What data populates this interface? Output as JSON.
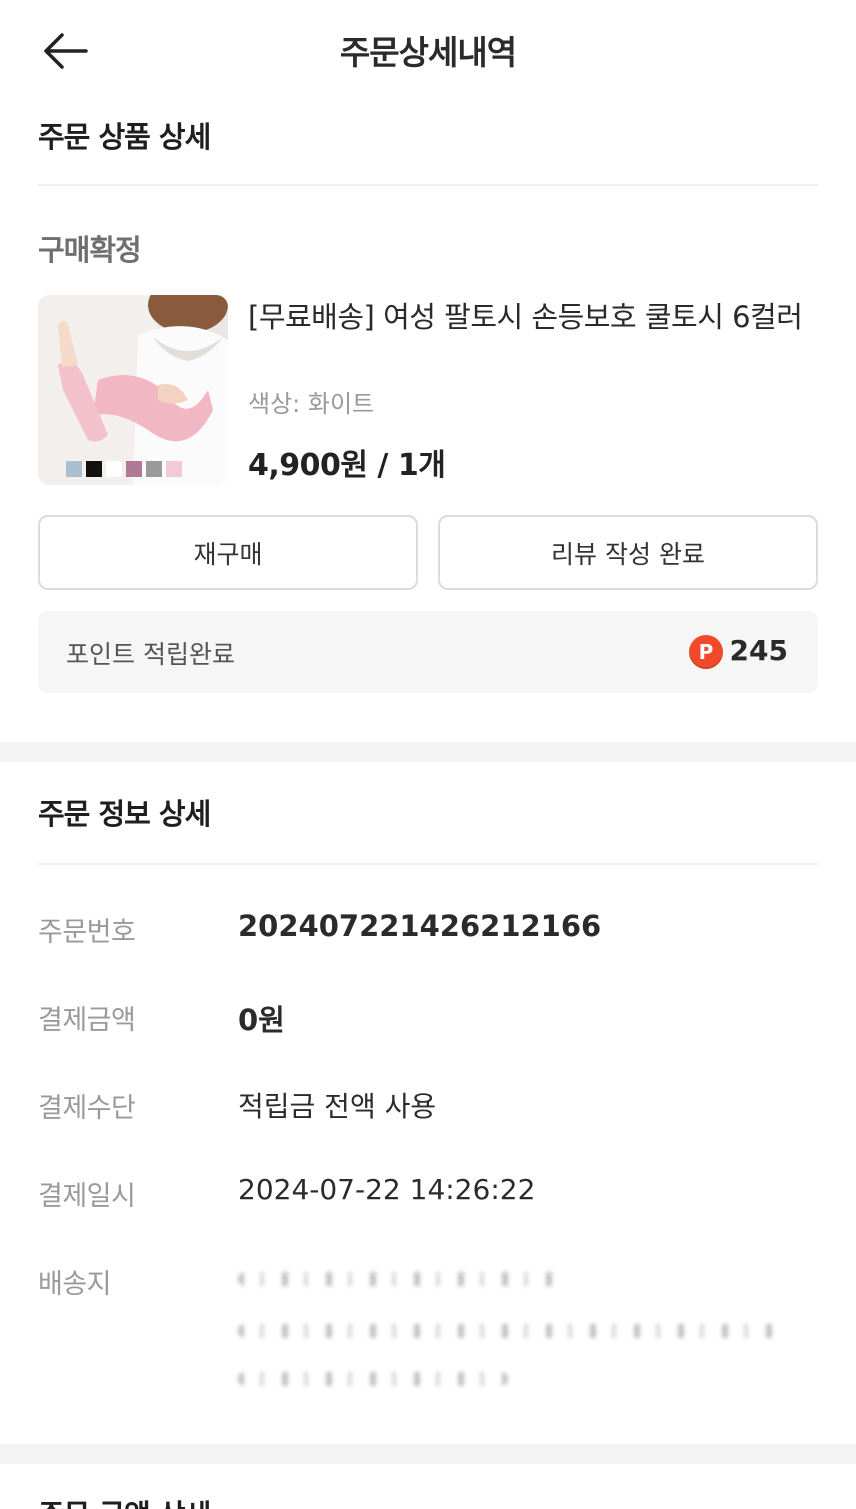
{
  "header": {
    "title": "주문상세내역"
  },
  "product_section": {
    "title": "주문 상품 상세",
    "status": "구매확정",
    "product": {
      "name": "[무료배송] 여성 팔토시 손등보호 쿨토시 6컬러",
      "option": "색상: 화이트",
      "price_qty": "4,900원 / 1개",
      "swatch_colors": [
        "#a9bfd0",
        "#111111",
        "#ffffff",
        "#b07a96",
        "#9a9a9a",
        "#f2c9d6"
      ]
    },
    "buttons": {
      "rebuy": "재구매",
      "review": "리뷰 작성 완료"
    },
    "points": {
      "label": "포인트 적립완료",
      "icon": "P",
      "value": "245"
    }
  },
  "order_info": {
    "title": "주문 정보 상세",
    "rows": [
      {
        "label": "주문번호",
        "value": "20240722142621​2166"
      },
      {
        "label": "결제금액",
        "value": "0원"
      },
      {
        "label": "결제수단",
        "value": "적립금 전액 사용"
      },
      {
        "label": "결제일시",
        "value": "2024-07-22 14:26:22"
      },
      {
        "label": "배송지",
        "value": ""
      }
    ]
  },
  "next_section": {
    "title": "주문 금액 상세"
  },
  "colors": {
    "accent": "#f04a2a",
    "divider": "#f1f1f1",
    "box_bg": "#f6f6f6"
  }
}
